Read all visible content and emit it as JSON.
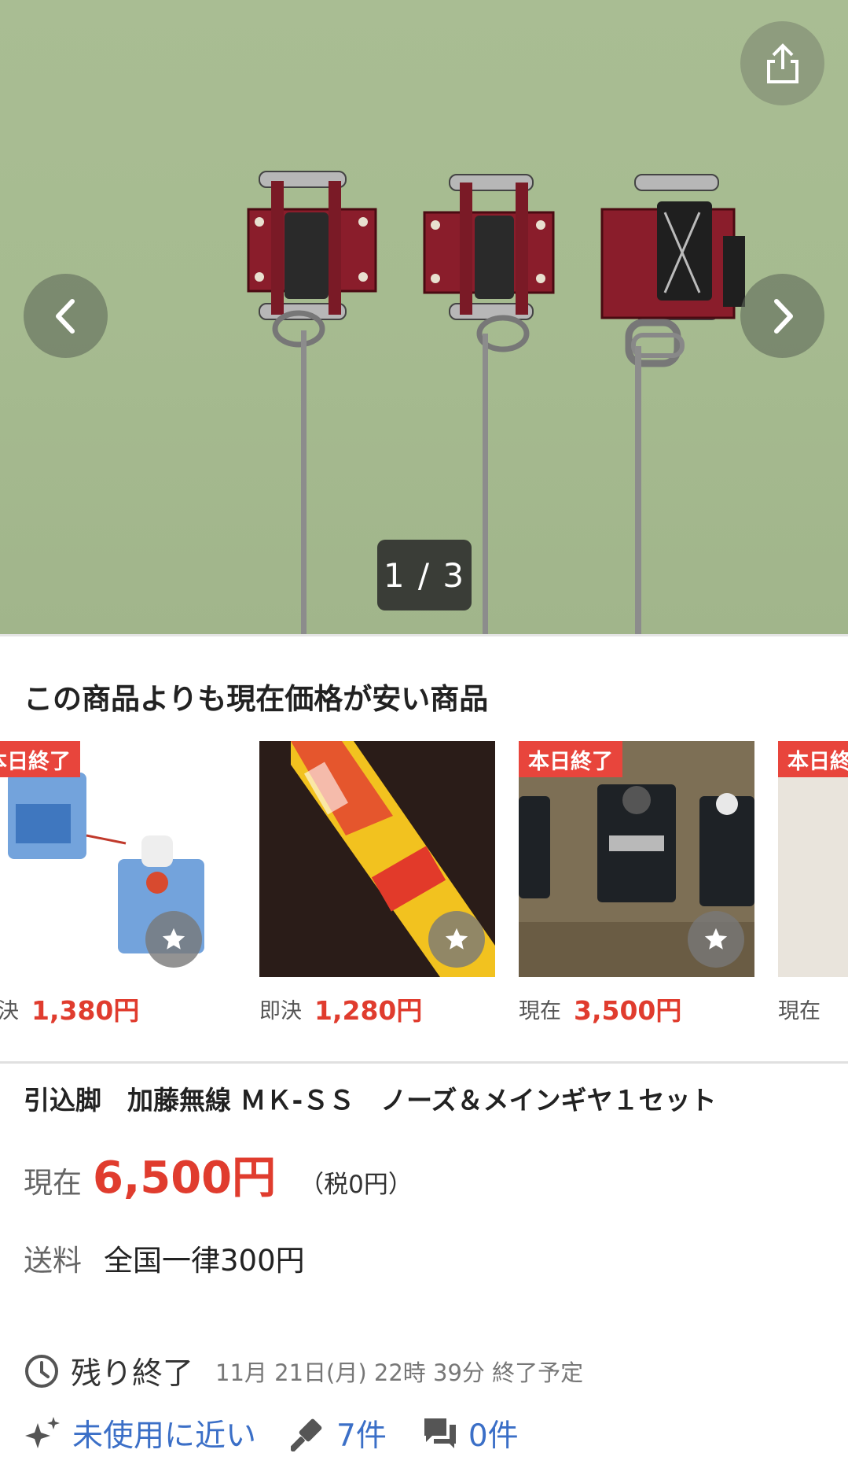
{
  "gallery": {
    "counter": "1 / 3"
  },
  "recommend": {
    "title": "この商品よりも現在価格が安い商品",
    "items": [
      {
        "badge": "本日終了",
        "price_label": "即決",
        "price": "1,380円"
      },
      {
        "badge": "",
        "price_label": "即決",
        "price": "1,280円"
      },
      {
        "badge": "本日終了",
        "price_label": "現在",
        "price": "3,500円"
      },
      {
        "badge": "本日終了",
        "price_label": "現在",
        "price": ""
      }
    ]
  },
  "item": {
    "title": "引込脚　加藤無線 ＭＫ-ＳＳ　ノーズ＆メインギヤ１セット",
    "current_label": "現在",
    "current_price": "6,500円",
    "tax": "（税0円）",
    "shipping_label": "送料",
    "shipping_value": "全国一律300円",
    "time_label": "残り終了",
    "end_time": "11月 21日(月) 22時 39分 終了予定",
    "condition": "未使用に近い",
    "bids": "7件",
    "questions": "0件"
  },
  "colors": {
    "accent": "#e03c2e",
    "link": "#3b6fc7",
    "badge": "#e8453c"
  }
}
